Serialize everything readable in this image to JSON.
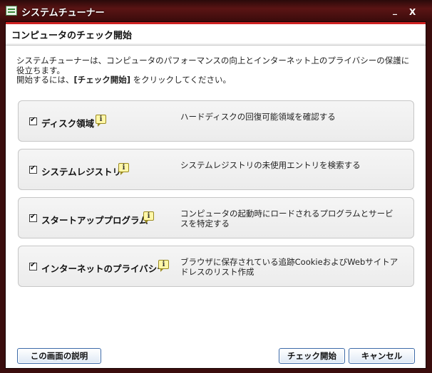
{
  "window": {
    "title": "システムチューナー",
    "minimize_glyph": "_",
    "close_glyph": "X"
  },
  "header": {
    "title": "コンピュータのチェック開始"
  },
  "intro": {
    "line1": "システムチューナーは、コンピュータのパフォーマンスの向上とインターネット上のプライバシーの保護に役立ちます。",
    "line2_prefix": "開始するには、",
    "line2_bold": "[チェック開始]",
    "line2_suffix": " をクリックしてください。"
  },
  "items": [
    {
      "label": "ディスク領域",
      "description": "ハードディスクの回復可能領域を確認する",
      "checked": true,
      "info_glyph": "i"
    },
    {
      "label": "システムレジストリ",
      "description": "システムレジストリの未使用エントリを検索する",
      "checked": true,
      "info_glyph": "i"
    },
    {
      "label": "スタートアッププログラム",
      "description": "コンピュータの起動時にロードされるプログラムとサービスを特定する",
      "checked": true,
      "info_glyph": "i"
    },
    {
      "label": "インターネットのプライバシー",
      "description": "ブラウザに保存されている追跡CookieおよびWebサイトアドレスのリスト作成",
      "checked": true,
      "info_glyph": "i"
    }
  ],
  "buttons": {
    "help": "この画面の説明",
    "start": "チェック開始",
    "cancel": "キャンセル"
  }
}
